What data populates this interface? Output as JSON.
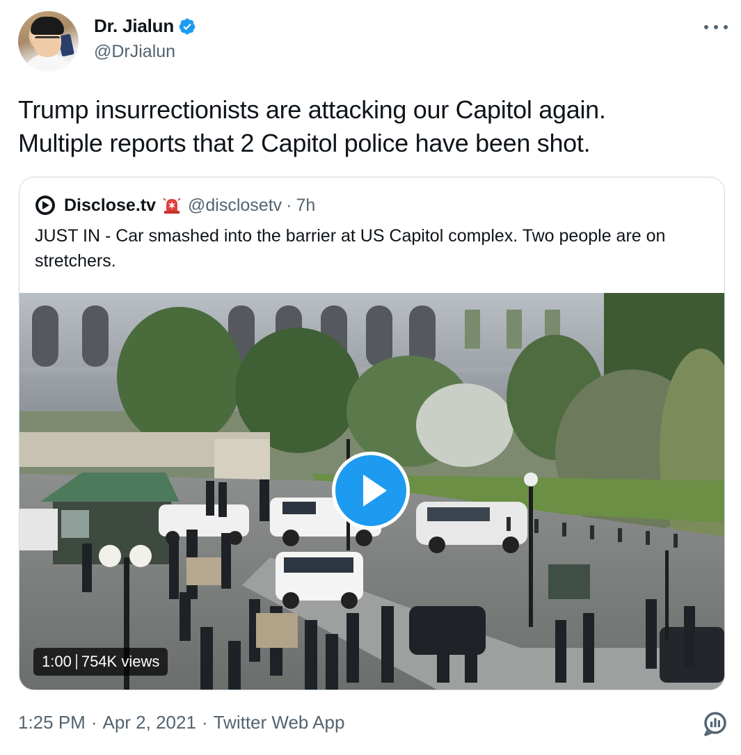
{
  "author": {
    "display_name": "Dr. Jialun",
    "handle": "@DrJialun",
    "verified": true
  },
  "tweet": {
    "text_line1": "Trump insurrectionists are attacking our Capitol again.",
    "text_line2": "Multiple reports that 2 Capitol police have been shot."
  },
  "quoted": {
    "display_name": "Disclose.tv",
    "emoji": "rotating-light-icon",
    "handle": "@disclosetv",
    "separator": "·",
    "time": "7h",
    "text": "JUST IN - Car smashed into the barrier at US Capitol complex. Two people are on stretchers.",
    "video": {
      "duration": "1:00",
      "views": "754K views"
    }
  },
  "footer": {
    "time": "1:25 PM",
    "separator": "·",
    "date": "Apr 2, 2021",
    "source": "Twitter Web App"
  },
  "colors": {
    "accent": "#1d9bf0",
    "text_primary": "#0f1419",
    "text_secondary": "#536471",
    "border": "#cfd9de"
  },
  "icons": {
    "more": "more-horizontal-icon",
    "verified": "verified-badge-icon",
    "analytics": "analytics-icon",
    "play": "play-icon",
    "disclose_logo": "disclose-logo-icon"
  }
}
